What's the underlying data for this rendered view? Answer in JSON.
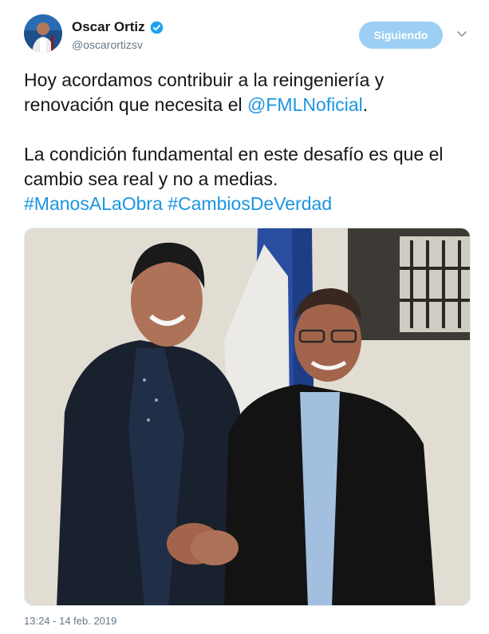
{
  "author": {
    "display_name": "Oscar Ortiz",
    "handle": "@oscarortizsv",
    "verified_icon": "verified-badge-icon"
  },
  "follow_button": {
    "label": "Siguiendo"
  },
  "menu": {
    "icon": "chevron-down-icon"
  },
  "tweet": {
    "paragraph1_text": "Hoy acordamos contribuir a la reingeniería y renovación que necesita el ",
    "paragraph1_mention": "@FMLNoficial",
    "paragraph1_end": ".",
    "paragraph2_text": "La condición fundamental en este desafío es que el cambio sea real y no a medias.",
    "hashtag1": "#ManosALaObra",
    "hashtag2": "#CambiosDeVerdad"
  },
  "timestamp": "13:24 - 14 feb. 2019",
  "colors": {
    "link": "#1b95e0",
    "follow_button_bg": "#9ccff3",
    "secondary_text": "#657786",
    "primary_text": "#14171a"
  }
}
